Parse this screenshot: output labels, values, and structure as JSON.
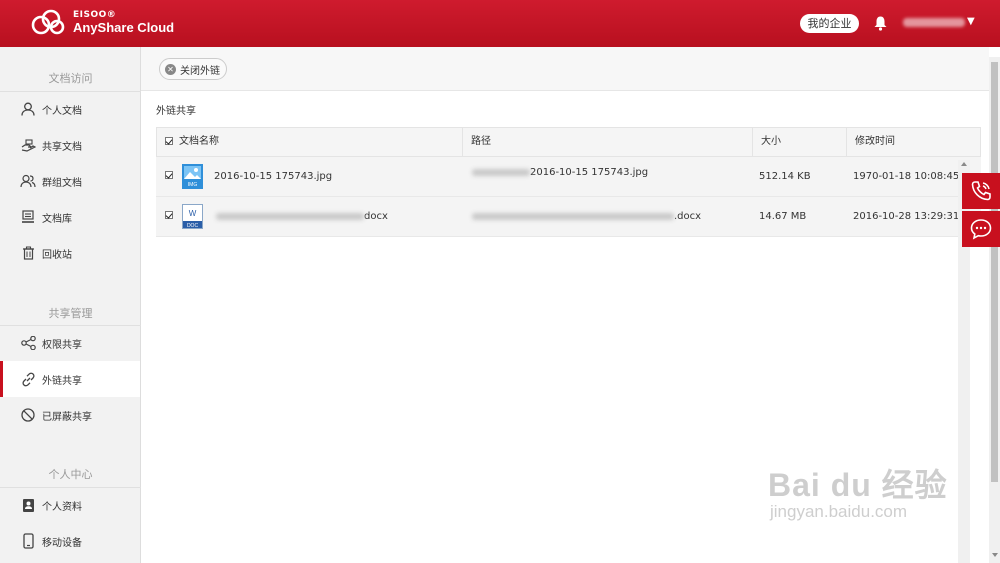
{
  "header": {
    "brand": "EISOO®",
    "product": "AnyShare Cloud",
    "enterprise_button": "我的企业",
    "user_name": "",
    "bg_color": "#c8101e"
  },
  "sidebar": {
    "sections": [
      {
        "title": "文档访问",
        "items": [
          {
            "label": "个人文档",
            "icon": "person-icon"
          },
          {
            "label": "共享文档",
            "icon": "shared-hand-icon"
          },
          {
            "label": "群组文档",
            "icon": "group-icon"
          },
          {
            "label": "文档库",
            "icon": "library-icon"
          },
          {
            "label": "回收站",
            "icon": "trash-icon"
          }
        ]
      },
      {
        "title": "共享管理",
        "items": [
          {
            "label": "权限共享",
            "icon": "share-icon"
          },
          {
            "label": "外链共享",
            "icon": "link-icon",
            "active": true
          },
          {
            "label": "已屏蔽共享",
            "icon": "blocked-icon"
          }
        ]
      },
      {
        "title": "个人中心",
        "items": [
          {
            "label": "个人资料",
            "icon": "profile-card-icon"
          },
          {
            "label": "移动设备",
            "icon": "mobile-icon"
          }
        ]
      }
    ]
  },
  "main": {
    "toolbar": {
      "close_link_label": "关闭外链"
    },
    "page_title": "外链共享",
    "table": {
      "columns": [
        "文档名称",
        "路径",
        "大小",
        "修改时间"
      ],
      "rows": [
        {
          "name": "2016-10-15 175743.jpg",
          "icon_label": "IMG",
          "path": "2016-10-15 175743.jpg",
          "size": "512.14 KB",
          "modified": "1970-01-18 10:08:45",
          "checked": true
        },
        {
          "name": "docx",
          "icon_label": "DOC",
          "path": ".docx",
          "size": "14.67 MB",
          "modified": "2016-10-28 13:29:31",
          "checked": true
        }
      ]
    }
  },
  "watermark": {
    "main": "Bai du 经验",
    "sub": "jingyan.baidu.com"
  }
}
